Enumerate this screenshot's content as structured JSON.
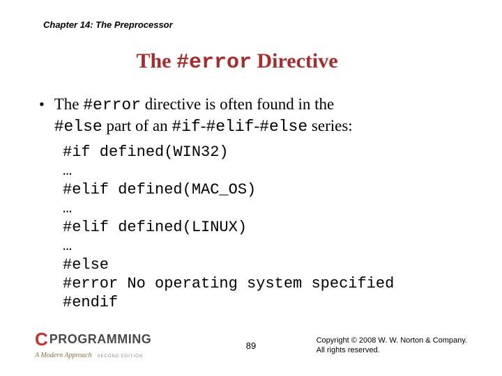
{
  "header": {
    "chapter": "Chapter 14: The Preprocessor"
  },
  "title": {
    "pre": "The ",
    "mono": "#error",
    "post": " Directive"
  },
  "bullet": {
    "t1": "The ",
    "m1": "#error",
    "t2": " directive is often found in the ",
    "m2": "#else",
    "t3": " part of an ",
    "m3": "#if",
    "t4": "-",
    "m4": "#elif",
    "t5": "-",
    "m5": "#else",
    "t6": " series:"
  },
  "code": "#if defined(WIN32)\n…\n#elif defined(MAC_OS)\n…\n#elif defined(LINUX)\n…\n#else\n#error No operating system specified\n#endif",
  "footer": {
    "logo_c": "C",
    "logo_prog": "PROGRAMMING",
    "logo_sub": "A Modern Approach",
    "logo_edition": "SECOND EDITION",
    "page": "89",
    "copy1": "Copyright © 2008 W. W. Norton & Company.",
    "copy2": "All rights reserved."
  }
}
